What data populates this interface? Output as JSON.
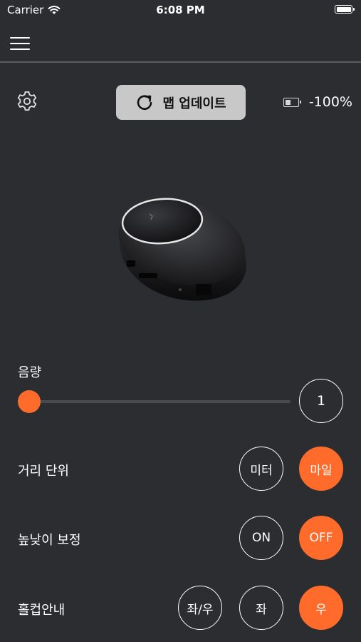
{
  "status_bar": {
    "carrier": "Carrier",
    "time": "6:08 PM"
  },
  "toolbar": {
    "map_update_label": "맵 업데이트",
    "battery_text": "-100%"
  },
  "volume": {
    "label": "음량",
    "value": "1",
    "level": 0
  },
  "distance_unit": {
    "label": "거리 단위",
    "options": [
      "미터",
      "마일"
    ],
    "selected": "마일"
  },
  "elevation_correction": {
    "label": "높낮이 보정",
    "options": [
      "ON",
      "OFF"
    ],
    "selected": "OFF"
  },
  "hole_cup_guide": {
    "label": "홀컵안내",
    "options": [
      "좌/우",
      "좌",
      "우"
    ],
    "selected": "우"
  },
  "colors": {
    "accent": "#ff6b2b",
    "background": "#2c2d31",
    "button_gray": "#c8c8c8"
  },
  "icons": [
    "wifi-icon",
    "menu-icon",
    "gear-icon",
    "refresh-icon",
    "battery-icon"
  ]
}
